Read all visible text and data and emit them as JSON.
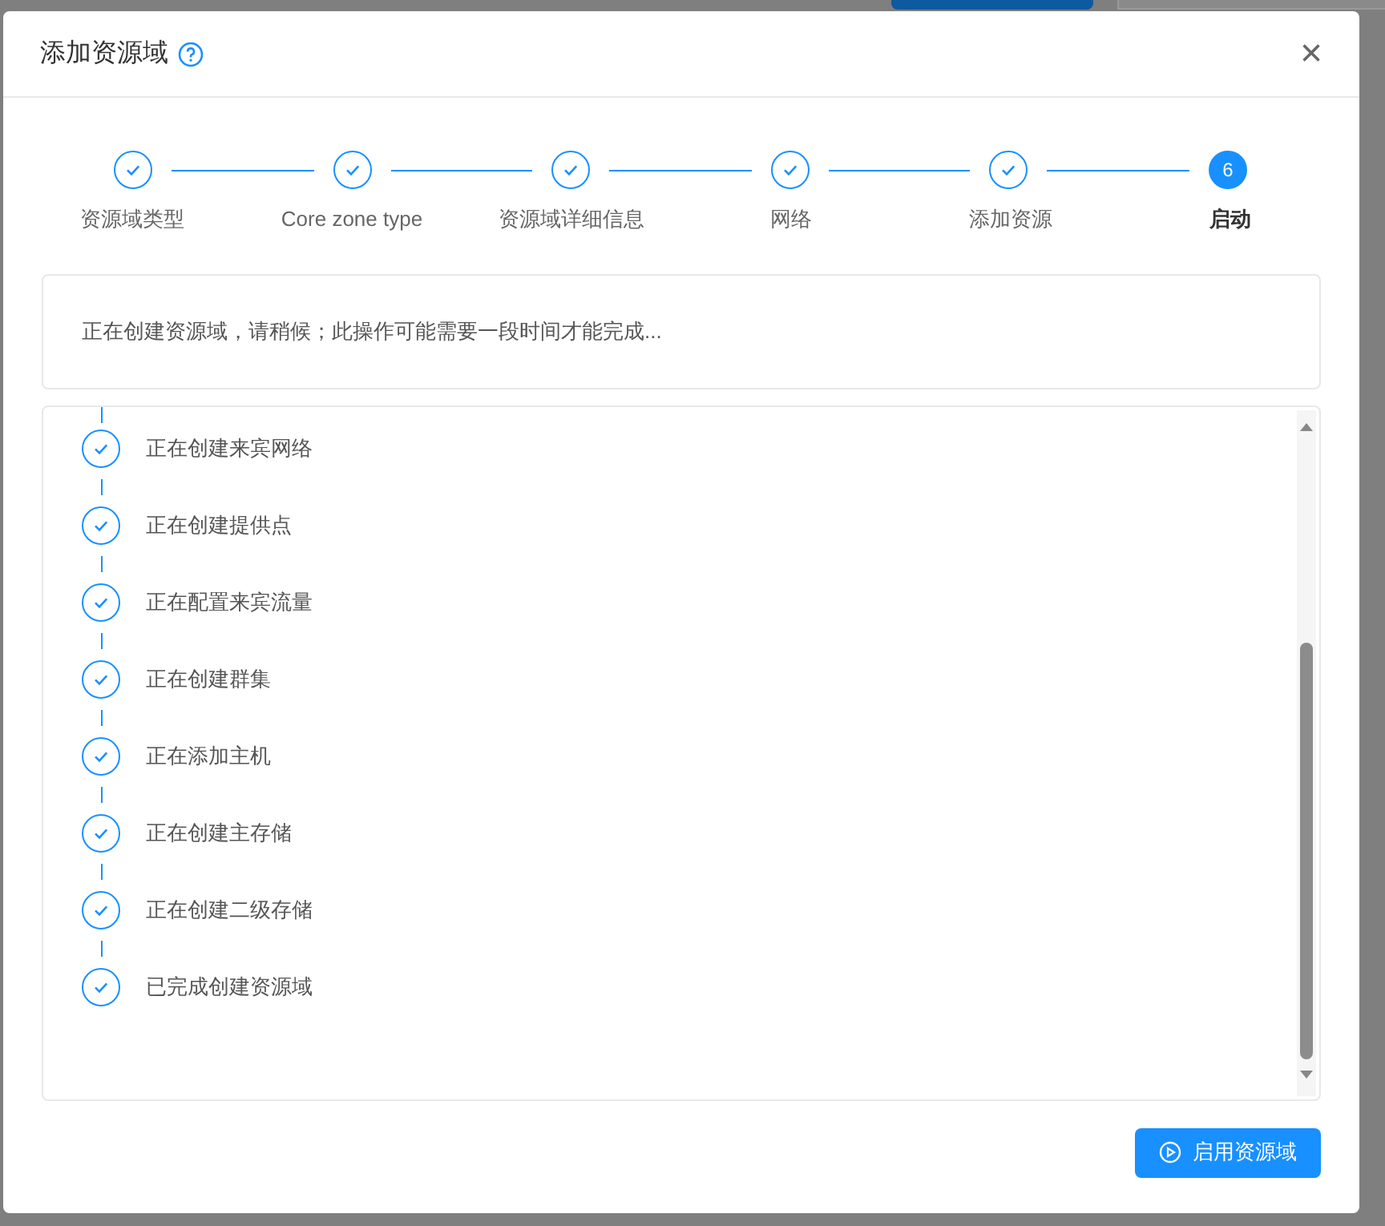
{
  "dialog": {
    "title": "添加资源域",
    "close": "×"
  },
  "steps": [
    {
      "label": "资源域类型",
      "completed": true,
      "selected": false
    },
    {
      "label": "Core zone type",
      "completed": true,
      "selected": false
    },
    {
      "label": "资源域详细信息",
      "completed": true,
      "selected": false
    },
    {
      "label": "网络",
      "completed": true,
      "selected": false
    },
    {
      "label": "添加资源",
      "completed": true,
      "selected": false
    },
    {
      "label": "启动",
      "completed": false,
      "selected": true,
      "number": "6"
    }
  ],
  "message": "正在创建资源域，请稍候；此操作可能需要一段时间才能完成...",
  "progress_log": [
    {
      "text": "正在创建来宾网络",
      "done": true
    },
    {
      "text": "正在创建提供点",
      "done": true
    },
    {
      "text": "正在配置来宾流量",
      "done": true
    },
    {
      "text": "正在创建群集",
      "done": true
    },
    {
      "text": "正在添加主机",
      "done": true
    },
    {
      "text": "正在创建主存储",
      "done": true
    },
    {
      "text": "正在创建二级存储",
      "done": true
    },
    {
      "text": "已完成创建资源域",
      "done": true
    }
  ],
  "footer_button": "启用资源域"
}
